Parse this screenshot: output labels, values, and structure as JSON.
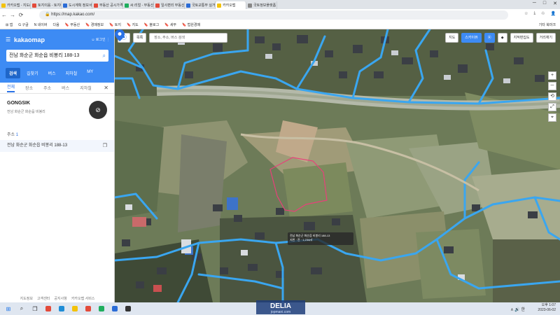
{
  "browser": {
    "tabs": [
      {
        "label": "카카오맵 - 지도/내비",
        "color": "#f3c20b",
        "active": false
      },
      {
        "label": "토지이음 - 토지이용",
        "color": "#e34a3a",
        "active": false
      },
      {
        "label": "도시계획 정보서비스",
        "color": "#2b6cd6",
        "active": false
      },
      {
        "label": "부동산 공시가격 알리",
        "color": "#e34a3a",
        "active": false
      },
      {
        "label": "씨:리얼 - 부동산",
        "color": "#1fae5e",
        "active": false
      },
      {
        "label": "일사편리 부동산",
        "color": "#e34a3a",
        "active": false
      },
      {
        "label": "국토교통부 실거래",
        "color": "#2b6cd6",
        "active": false
      },
      {
        "label": "카카오맵",
        "color": "#f3c20b",
        "active": true
      },
      {
        "label": "국토정보플랫폼",
        "color": "#888888",
        "active": false
      }
    ],
    "url": "https://map.kakao.com/",
    "window_controls": [
      "─",
      "□",
      "✕"
    ],
    "address_icons": [
      "☆",
      "⤓",
      "♲",
      "👤"
    ],
    "bookmarks": [
      "⊞ 앱",
      "G 구글",
      "N 네이버",
      "다음",
      "🔖 부동산",
      "🔖 경매정보",
      "🔖 토지",
      "🔖 지도",
      "🔖 블로그",
      "🔖 세무",
      "🔖 법원경매"
    ],
    "bookmarks_right": "기타 북마크"
  },
  "panel": {
    "logo": "kakaomap",
    "header_right": "☺ 로그인 ⋮",
    "search_value": "전남 화순군 화순읍 비봉리 188-13",
    "tabs": [
      "검색",
      "길찾기",
      "버스",
      "지하철",
      "MY"
    ],
    "active_tab": 0,
    "subtabs": [
      "전체",
      "장소",
      "주소",
      "버스",
      "지하철"
    ],
    "active_subtab": 0,
    "place_name": "GONGSIK",
    "place_sub": "전남 화순군 화순읍 비봉리",
    "place_icon": "no-smoking-icon",
    "count_label": "주소",
    "count_value": "1",
    "result": "전남 화순군 화순읍 비봉리 188-13",
    "footer": [
      "지도정보",
      "고객센터",
      "공지사항",
      "카카오맵 서비스"
    ]
  },
  "map": {
    "search_placeholder": "장소, 주소, 버스 검색",
    "left_buttons": [
      "위치",
      "목록"
    ],
    "right_buttons": [
      "지도",
      "스카이뷰",
      "로드뷰",
      "지적편집도",
      "거리재기"
    ],
    "tooltip_lines": [
      "전남 화순군 화순읍 비봉리 188-13",
      "지번 · 전 · 1,234㎡"
    ],
    "zoom_controls": [
      "+",
      "─",
      "⟲",
      "⤢",
      "⌖"
    ],
    "roadline_color": "#3aa6f0",
    "parcel_color": "#e8407a",
    "marker_color": "#2a72e6"
  },
  "watermark": {
    "top": "DELIA",
    "bottom": "jopmani.com"
  },
  "taskbar": {
    "icons": [
      {
        "name": "start",
        "glyph": "⊞",
        "color": "#1a73e8"
      },
      {
        "name": "search",
        "glyph": "⌕",
        "color": "#333333"
      },
      {
        "name": "taskview",
        "glyph": "❐",
        "color": "#333333"
      },
      {
        "name": "chrome",
        "glyph": "",
        "color": "#e34a3a"
      },
      {
        "name": "edge",
        "glyph": "",
        "color": "#1f8dd6"
      },
      {
        "name": "explorer",
        "glyph": "",
        "color": "#f3c20b"
      },
      {
        "name": "app1",
        "glyph": "",
        "color": "#e34a3a"
      },
      {
        "name": "app2",
        "glyph": "",
        "color": "#1fae5e"
      },
      {
        "name": "app3",
        "glyph": "",
        "color": "#2b6cd6"
      },
      {
        "name": "app4",
        "glyph": "",
        "color": "#333333"
      }
    ],
    "tray": "∧ 🔊 한",
    "time": "오후 1:07",
    "date": "2023-06-02"
  }
}
